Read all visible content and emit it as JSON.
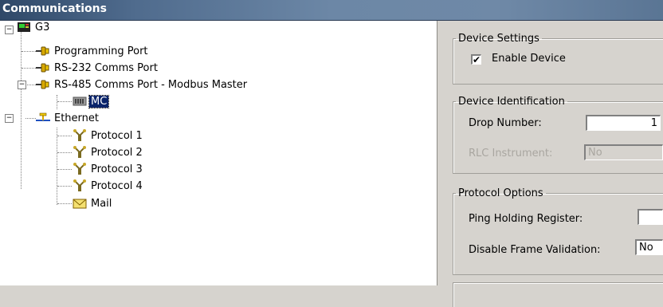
{
  "window": {
    "title": "Communications"
  },
  "tree": {
    "root": "G3",
    "programming_port": "Programming Port",
    "rs232": "RS-232 Comms Port",
    "rs485": "RS-485 Comms Port - Modbus Master",
    "mc": "MC",
    "ethernet": "Ethernet",
    "protocols": [
      "Protocol 1",
      "Protocol 2",
      "Protocol 3",
      "Protocol 4"
    ],
    "mail": "Mail",
    "collapse_glyph": "−"
  },
  "device_settings": {
    "legend": "Device Settings",
    "enable_label": "Enable Device",
    "enable_checked": true,
    "check_glyph": "✔"
  },
  "device_identification": {
    "legend": "Device Identification",
    "drop_label": "Drop Number:",
    "drop_value": "1",
    "rlc_label": "RLC Instrument:",
    "rlc_value": "No"
  },
  "protocol_options": {
    "legend": "Protocol Options",
    "ping_label": "Ping Holding Register:",
    "ping_value": "",
    "frame_label": "Disable Frame Validation:",
    "frame_value": "No"
  },
  "colors": {
    "title_bg": "#4f6b8d",
    "selection": "#0a246a",
    "panel": "#d6d3ce"
  },
  "icons": [
    "controller-icon",
    "serial-port-icon",
    "device-icon",
    "ethernet-icon",
    "protocol-icon",
    "mail-icon"
  ]
}
